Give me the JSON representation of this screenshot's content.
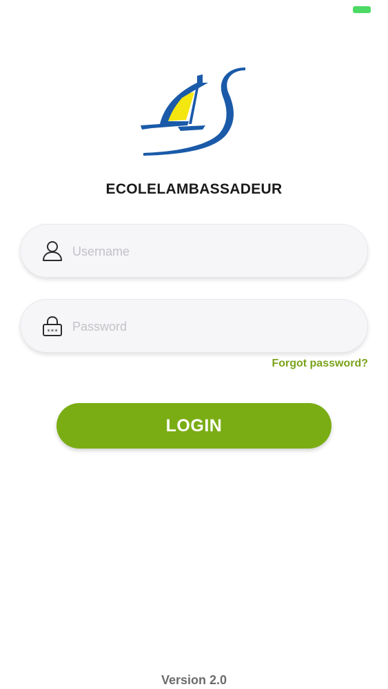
{
  "status_bar": {
    "battery_color": "#4cd964",
    "battery_icon": "battery-icon"
  },
  "logo": {
    "icon": "sailboat-logo",
    "colors": {
      "blue": "#1a5aa8",
      "yellow": "#f4e60f"
    }
  },
  "school_name": "ECOLELAMBASSADEUR",
  "login_form": {
    "username": {
      "value": "",
      "placeholder": "Username",
      "icon": "user-icon"
    },
    "password": {
      "value": "",
      "placeholder": "Password",
      "icon": "padlock-icon"
    },
    "forgot_password": "Forgot password?",
    "login_button": "LOGIN"
  },
  "footer": {
    "version": "Version 2.0"
  },
  "colors": {
    "accent_green": "#7aad14",
    "link_green": "#7aa31a",
    "field_background": "#f6f6f8"
  }
}
